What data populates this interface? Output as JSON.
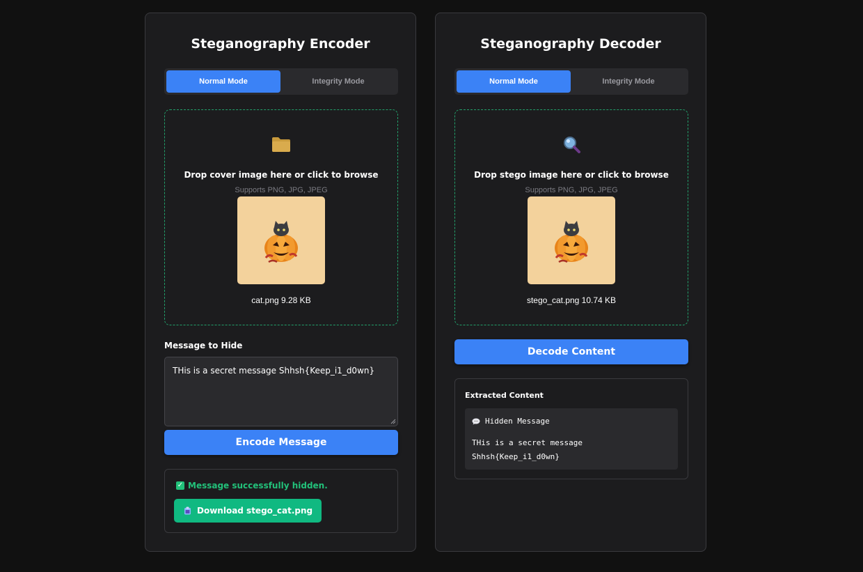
{
  "encoder": {
    "title": "Steganography Encoder",
    "modes": [
      "Normal Mode",
      "Integrity Mode"
    ],
    "active_mode": "Normal Mode",
    "dropzone": {
      "icon": "folder-icon",
      "title": "Drop cover image here or click to browse",
      "subtitle": "Supports PNG, JPG, JPEG",
      "file_name": "cat.png",
      "file_size": "9.28 KB",
      "file_info": "cat.png 9.28 KB"
    },
    "message_label": "Message to Hide",
    "message_value": "THis is a secret message Shhsh{Keep_i1_d0wn}",
    "encode_label": "Encode Message",
    "result": {
      "success_text": "Message successfully hidden.",
      "download_label": "Download stego_cat.png"
    }
  },
  "decoder": {
    "title": "Steganography Decoder",
    "modes": [
      "Normal Mode",
      "Integrity Mode"
    ],
    "active_mode": "Normal Mode",
    "dropzone": {
      "icon": "magnifier-icon",
      "title": "Drop stego image here or click to browse",
      "subtitle": "Supports PNG, JPG, JPEG",
      "file_name": "stego_cat.png",
      "file_size": "10.74 KB",
      "file_info": "stego_cat.png 10.74 KB"
    },
    "decode_label": "Decode Content",
    "extracted": {
      "title": "Extracted Content",
      "header": "Hidden Message",
      "message": "THis is a secret message Shhsh{Keep_i1_d0wn}"
    }
  },
  "colors": {
    "background": "#111111",
    "panel": "#1c1c1e",
    "accent_blue": "#3b82f6",
    "success_green": "#10b981",
    "dropzone_border": "#22a06b"
  }
}
